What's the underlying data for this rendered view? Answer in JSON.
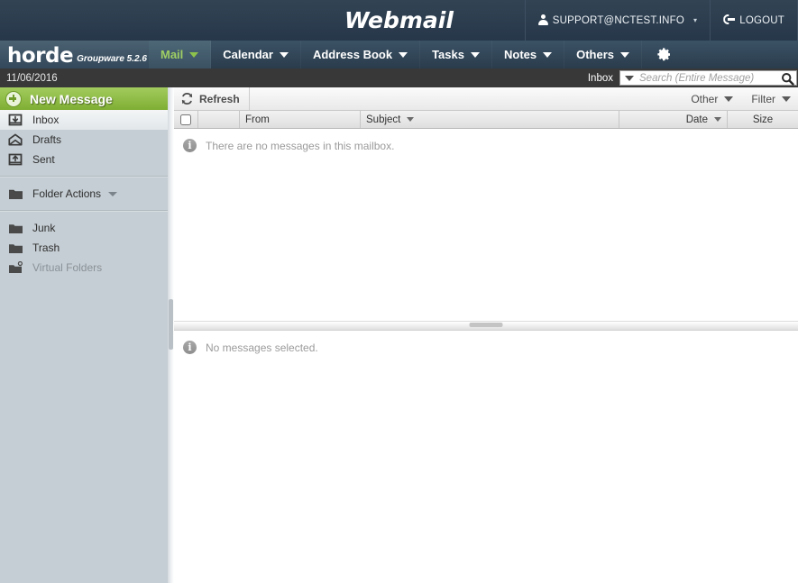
{
  "topbar": {
    "title": "Webmail",
    "account": {
      "icon": "person-icon",
      "label": "SUPPORT@NCTEST.INFO",
      "caret": "▼"
    },
    "logout": {
      "icon": "logout-icon",
      "label": "LOGOUT"
    }
  },
  "navbar": {
    "logo": {
      "word": "horde",
      "subtitle": "Groupware 5.2.6"
    },
    "items": [
      {
        "label": "Mail",
        "active": true,
        "has_caret": true
      },
      {
        "label": "Calendar",
        "active": false,
        "has_caret": true
      },
      {
        "label": "Address Book",
        "active": false,
        "has_caret": true
      },
      {
        "label": "Tasks",
        "active": false,
        "has_caret": true
      },
      {
        "label": "Notes",
        "active": false,
        "has_caret": true
      },
      {
        "label": "Others",
        "active": false,
        "has_caret": true
      }
    ],
    "gear_icon": "gear-icon"
  },
  "substrip": {
    "date": "11/06/2016",
    "search": {
      "mailbox_label": "Inbox",
      "placeholder": "Search (Entire Message)",
      "value": "",
      "magnifier_icon": "search-icon",
      "dropdown_icon": "chevron-down-icon"
    }
  },
  "sidebar": {
    "new_message": {
      "label": "New Message",
      "icon": "plus-circle-icon"
    },
    "folders": [
      {
        "label": "Inbox",
        "icon": "inbox-icon",
        "selected": true,
        "muted": false
      },
      {
        "label": "Drafts",
        "icon": "drafts-envelope-icon",
        "selected": false,
        "muted": false
      },
      {
        "label": "Sent",
        "icon": "sent-icon",
        "selected": false,
        "muted": false
      }
    ],
    "folder_actions": {
      "label": "Folder Actions",
      "icon": "folder-icon",
      "caret": "▼"
    },
    "special_folders": [
      {
        "label": "Junk",
        "icon": "folder-icon",
        "muted": false
      },
      {
        "label": "Trash",
        "icon": "folder-icon",
        "muted": false
      },
      {
        "label": "Virtual Folders",
        "icon": "virtual-folder-icon",
        "muted": true
      }
    ]
  },
  "main": {
    "toolbar": {
      "refresh_label": "Refresh",
      "refresh_icon": "refresh-icon",
      "other_label": "Other",
      "filter_label": "Filter"
    },
    "columns": {
      "from": "From",
      "subject": "Subject",
      "date": "Date",
      "size": "Size"
    },
    "message_list": {
      "empty_text": "There are no messages in this mailbox.",
      "info_icon": "info-icon",
      "info_glyph": "i"
    },
    "preview": {
      "empty_text": "No messages selected.",
      "info_icon": "info-icon",
      "info_glyph": "i"
    }
  },
  "colors": {
    "topbar": "#2b3b4b",
    "navbar": "#2f4354",
    "nav_active_text": "#9fce63",
    "substrip": "#383838",
    "sidebar_bg": "#c5ced4",
    "new_message_green": "#8fbf46",
    "muted_text": "#8a9298"
  }
}
